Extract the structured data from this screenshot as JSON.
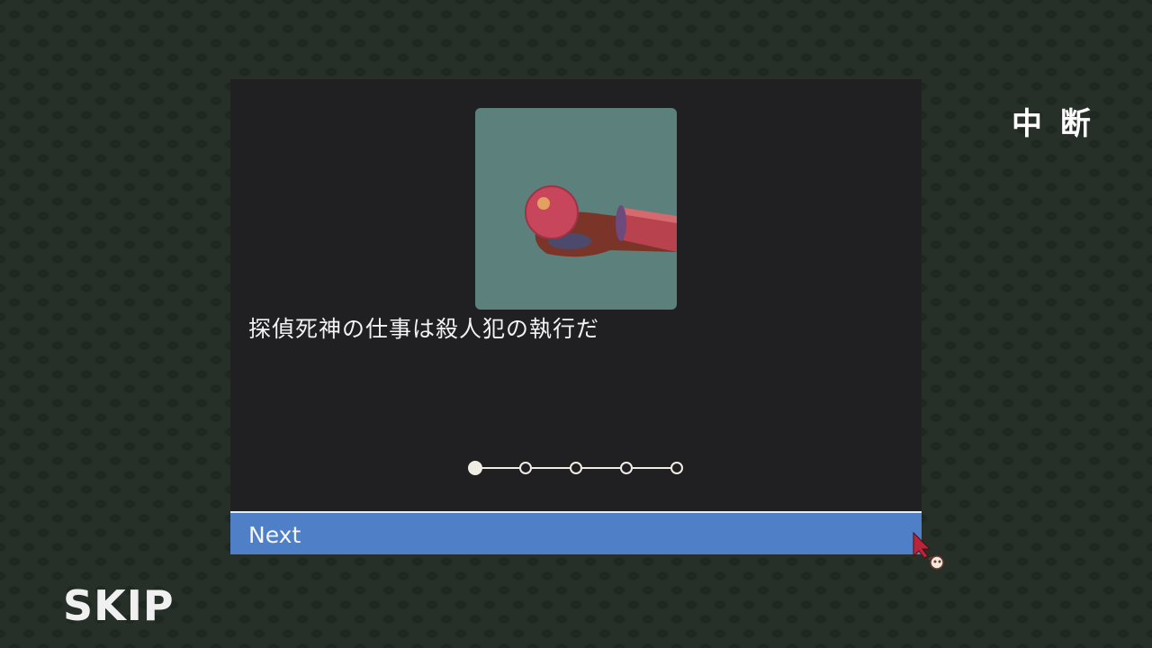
{
  "dialog": {
    "caption": "探偵死神の仕事は殺人犯の執行だ",
    "pager": {
      "total": 5,
      "current": 1
    },
    "next_label": "Next"
  },
  "interrupt_label": "中 断",
  "skip_label": "SKIP",
  "colors": {
    "background": "#263029",
    "panel": "#202023",
    "illustration_bg": "#5c807b",
    "next_bar": "#4f80c7",
    "text": "#f2f2f2"
  },
  "icons": {
    "cursor": "pointer-arrow-icon",
    "illustration": "ball-and-severed-tube-illustration"
  }
}
